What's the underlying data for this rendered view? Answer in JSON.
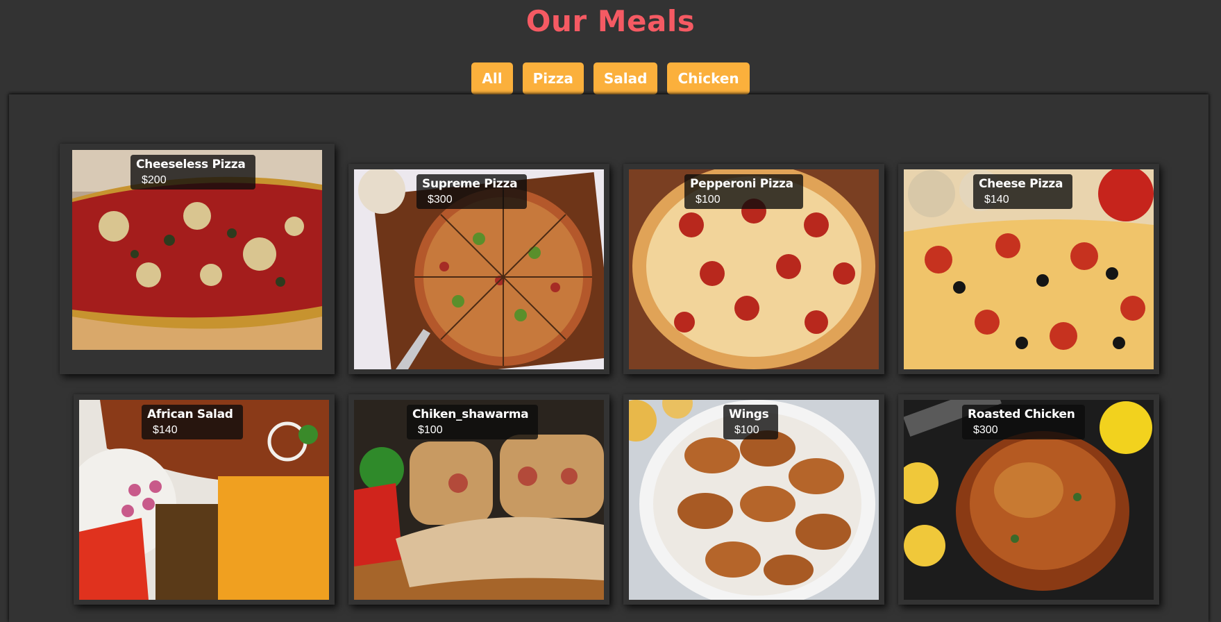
{
  "header": {
    "title": "Our Meals"
  },
  "filters": [
    {
      "label": "All"
    },
    {
      "label": "Pizza"
    },
    {
      "label": "Salad"
    },
    {
      "label": "Chicken"
    }
  ],
  "meals": [
    {
      "name": "Cheeseless Pizza",
      "price": "$200",
      "image": "pizza-photo"
    },
    {
      "name": "Supreme Pizza",
      "price": "$300",
      "image": "pizza-photo"
    },
    {
      "name": "Pepperoni Pizza",
      "price": "$100",
      "image": "pizza-photo"
    },
    {
      "name": "Cheese Pizza",
      "price": "$140",
      "image": "pizza-photo"
    },
    {
      "name": "African Salad",
      "price": "$140",
      "image": "salad-photo"
    },
    {
      "name": "Chiken_shawarma",
      "price": "$100",
      "image": "shawarma-photo"
    },
    {
      "name": "Wings",
      "price": "$100",
      "image": "chicken-wings-photo"
    },
    {
      "name": "Roasted Chicken",
      "price": "$300",
      "image": "roasted-chicken-photo"
    }
  ],
  "colors": {
    "background": "#333333",
    "title": "#f55a63",
    "button": "#fbb03c",
    "label_background": "#0c0c0c"
  }
}
